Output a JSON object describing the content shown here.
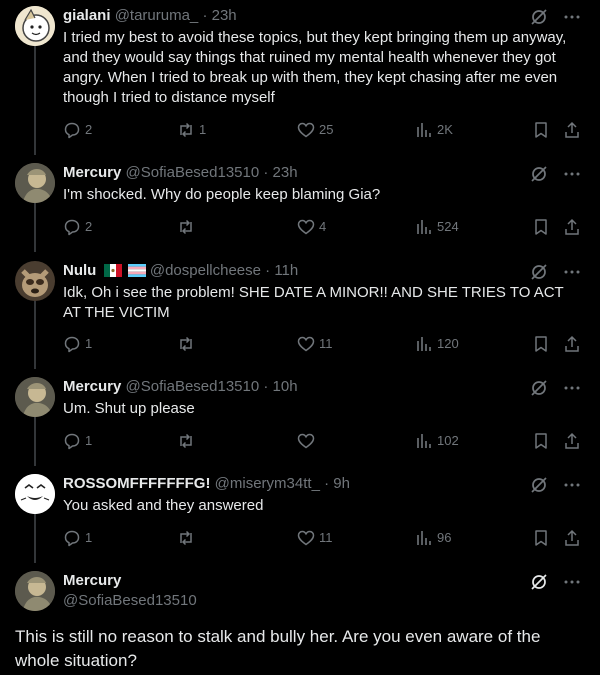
{
  "posts": [
    {
      "name": "gialani",
      "handle": "@taruruma_",
      "sep": "·",
      "time": "23h",
      "text": "I tried my best to avoid these topics, but they kept bringing them up anyway, and they would say things that ruined my mental health whenever they got angry. When I tried to break up with them, they kept chasing after me even though I tried to distance myself",
      "replies": "2",
      "reposts": "1",
      "likes": "25",
      "views": "2K"
    },
    {
      "name": "Mercury",
      "handle": "@SofiaBesed13510",
      "sep": "·",
      "time": "23h",
      "text": "I'm shocked. Why do people keep blaming Gia?",
      "replies": "2",
      "reposts": "",
      "likes": "4",
      "views": "524"
    },
    {
      "name": "Nulu",
      "flags": [
        "mexico-flag",
        "transgender-flag"
      ],
      "handle": "@dospellcheese",
      "sep": "·",
      "time": "11h",
      "text": "Idk, Oh i see the problem! SHE DATE A MINOR!! AND SHE TRIES TO ACT AT THE VICTIM",
      "replies": "1",
      "reposts": "",
      "likes": "11",
      "views": "120"
    },
    {
      "name": "Mercury",
      "handle": "@SofiaBesed13510",
      "sep": "·",
      "time": "10h",
      "text": "Um. Shut up please",
      "replies": "1",
      "reposts": "",
      "likes": "",
      "views": "102"
    },
    {
      "name": "ROSSOMFFFFFFFG!",
      "handle": "@miserym34tt_",
      "sep": "·",
      "time": "9h",
      "text": "You asked and they answered",
      "replies": "1",
      "reposts": "",
      "likes": "11",
      "views": "96"
    }
  ],
  "main_post": {
    "name": "Mercury",
    "handle": "@SofiaBesed13510",
    "text": "This is still no reason to stalk and bully her. Are you even aware of the whole situation?"
  },
  "colors": {
    "background": "#000000",
    "text": "#e7e9ea",
    "secondary": "#71767b",
    "thread_line": "#333639"
  }
}
